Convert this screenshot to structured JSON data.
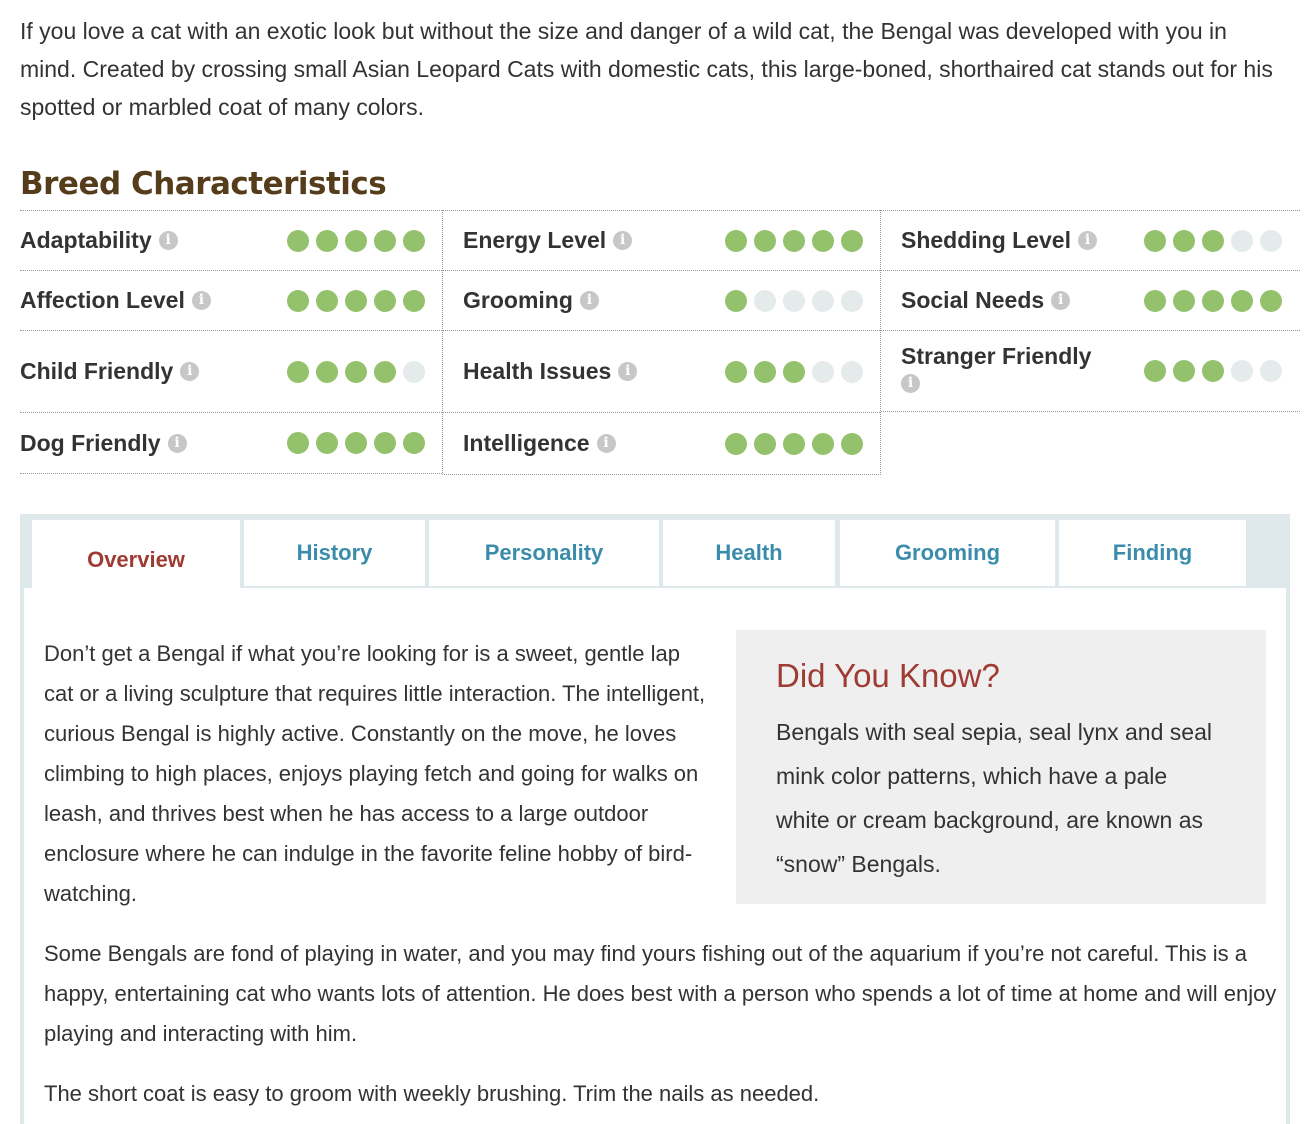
{
  "intro": "If you love a cat with an exotic look but without the size and danger of a wild cat, the Bengal was developed with you in mind. Created by crossing small Asian Leopard Cats with domestic cats, this large-boned, shorthaired cat stands out for his spotted or marbled coat of many colors.",
  "breed_characteristics": {
    "title": "Breed Characteristics",
    "info_glyph": "i",
    "columns": [
      [
        {
          "label": "Adaptability",
          "rating": 5,
          "max": 5
        },
        {
          "label": "Affection Level",
          "rating": 5,
          "max": 5
        },
        {
          "label": "Child Friendly",
          "rating": 4,
          "max": 5
        },
        {
          "label": "Dog Friendly",
          "rating": 5,
          "max": 5
        }
      ],
      [
        {
          "label": "Energy Level",
          "rating": 5,
          "max": 5
        },
        {
          "label": "Grooming",
          "rating": 1,
          "max": 5
        },
        {
          "label": "Health Issues",
          "rating": 3,
          "max": 5
        },
        {
          "label": "Intelligence",
          "rating": 5,
          "max": 5
        }
      ],
      [
        {
          "label": "Shedding Level",
          "rating": 3,
          "max": 5
        },
        {
          "label": "Social Needs",
          "rating": 5,
          "max": 5
        },
        {
          "label": "Stranger Friendly",
          "rating": 3,
          "max": 5
        }
      ]
    ],
    "colors": {
      "filled": "#94c16b",
      "empty": "#e5eaeb"
    }
  },
  "tabs": [
    {
      "label": "Overview",
      "active": true
    },
    {
      "label": "History",
      "active": false
    },
    {
      "label": "Personality",
      "active": false
    },
    {
      "label": "Health",
      "active": false
    },
    {
      "label": "Grooming",
      "active": false
    },
    {
      "label": "Finding",
      "active": false
    }
  ],
  "overview": {
    "paragraph1": "Don’t get a Bengal if what you’re looking for is a sweet, gentle lap cat or a living sculpture that requires little interaction. The intelligent, curious Bengal is highly active. Constantly on the move, he loves climbing to high places, enjoys playing fetch and going for walks on leash, and thrives best when he has access to a large outdoor enclosure where he can indulge in the favorite feline hobby of bird-watching.",
    "did_you_know": {
      "title": "Did You Know?",
      "text": "Bengals with seal sepia, seal lynx and seal mink color patterns, which have a pale white or cream background, are known as “snow” Bengals."
    },
    "paragraph2": "Some Bengals are fond of playing in water, and you may find yours fishing out of the aquarium if you’re not careful. This is a happy, entertaining cat who wants lots of attention. He does best with a person who spends a lot of time at home and will enjoy playing and interacting with him.",
    "paragraph3": "The short coat is easy to groom with weekly brushing. Trim the nails as needed."
  },
  "theme": {
    "title_color": "#553c1a",
    "tab_active_color": "#9e3b33",
    "tab_color": "#3b8cab"
  }
}
